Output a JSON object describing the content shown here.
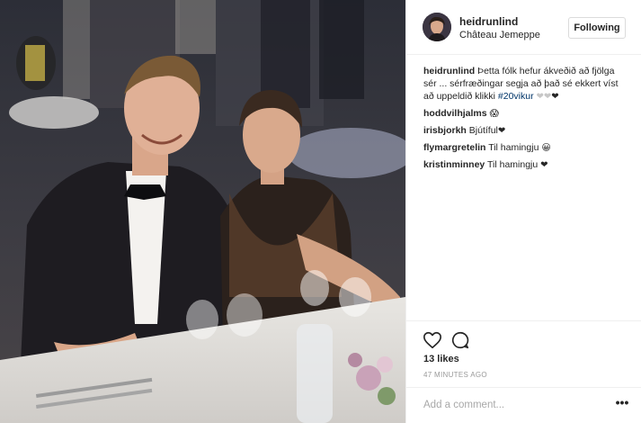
{
  "post": {
    "author": "heidrunlind",
    "location": "Château Jemeppe",
    "follow_label": "Following",
    "caption_author": "heidrunlind",
    "caption_text": "Þetta fólk hefur ákveðið að fjölga sér ... sérfræðingar segja að það sé ekkert víst að uppeldið klikki ",
    "caption_hashtag": "#20vikur",
    "caption_faded": "❤❤",
    "caption_emoji": "❤",
    "comments": [
      {
        "user": "hoddvilhjalms",
        "text": "",
        "emoji": "😱"
      },
      {
        "user": "irisbjorkh",
        "text": "Bjútíful",
        "emoji": "❤"
      },
      {
        "user": "flymargretelin",
        "text": "Til hamingju ",
        "emoji": "😀"
      },
      {
        "user": "kristinminney",
        "text": "Til hamingju ",
        "emoji": "❤"
      }
    ],
    "likes": "13 likes",
    "time": "47 MINUTES AGO",
    "add_comment_placeholder": "Add a comment...",
    "more_label": "•••"
  },
  "icons": {
    "like": "heart-icon",
    "comment": "speech-bubble-icon",
    "more": "more-options-icon"
  },
  "colors": {
    "text": "#262626",
    "hashtag": "#003569",
    "muted": "#999999",
    "border": "#efefef"
  }
}
